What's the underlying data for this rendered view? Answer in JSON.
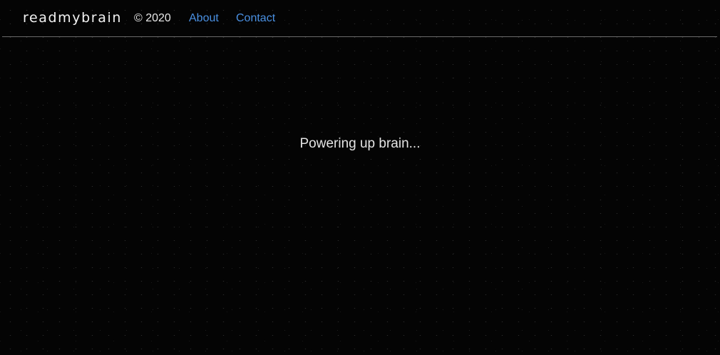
{
  "header": {
    "brand": "readmybrain",
    "copyright": "© 2020",
    "nav": {
      "about": "About",
      "contact": "Contact"
    }
  },
  "main": {
    "status_text": "Powering up brain..."
  },
  "colors": {
    "background": "#040404",
    "link": "#4a90e2",
    "text": "#e8e8e8",
    "divider": "#6b6b6b"
  }
}
